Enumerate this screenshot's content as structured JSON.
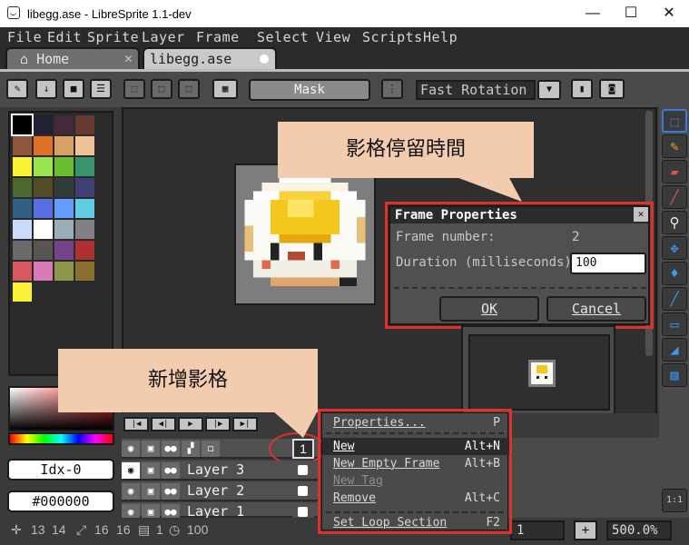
{
  "window": {
    "title": "libegg.ase - LibreSprite 1.1-dev",
    "minimize": "—",
    "maximize": "☐",
    "close": "✕"
  },
  "menubar": [
    "File",
    "Edit",
    "Sprite",
    "Layer",
    "Frame",
    "Select",
    "View",
    "Scripts",
    "Help"
  ],
  "tabs": [
    {
      "label": "Home",
      "icon": "home-icon",
      "close": "✕"
    },
    {
      "label": "libegg.ase",
      "modified": true
    }
  ],
  "toolbar": {
    "mask_label": "Mask",
    "rotation_algorithm": "Fast Rotation"
  },
  "palette": {
    "colors": [
      "#000000",
      "#222034",
      "#45283c",
      "#663931",
      "#8f563b",
      "#df7126",
      "#d9a066",
      "#eec39a",
      "#fbf236",
      "#99e550",
      "#6abe30",
      "#37946e",
      "#4b692f",
      "#524b24",
      "#323c39",
      "#3f3f74",
      "#306082",
      "#5b6ee1",
      "#639bff",
      "#5fcde4",
      "#cbdbfc",
      "#ffffff",
      "#9badb7",
      "#847e87",
      "#696a6a",
      "#595652",
      "#76428a",
      "#ac3232",
      "#d95763",
      "#d77bba",
      "#8f974a",
      "#8a6f30",
      "#fbf236"
    ]
  },
  "color_bar": {
    "index": "Idx-0",
    "hex": "#000000"
  },
  "dialog": {
    "title": "Frame Properties",
    "frame_number_label": "Frame number:",
    "frame_number_value": "2",
    "duration_label": "Duration (milliseconds):",
    "duration_value": "100",
    "ok_label": "OK",
    "cancel_label": "Cancel"
  },
  "callouts": {
    "top": "影格停留時間",
    "bottom": "新增影格"
  },
  "timeline": {
    "current_frame": "1",
    "layers": [
      "Layer 3",
      "Layer 2",
      "Layer 1"
    ]
  },
  "context_menu": [
    {
      "label": "Properties...",
      "shortcut": "P",
      "state": "normal"
    },
    {
      "label": "New",
      "shortcut": "Alt+N",
      "state": "selected"
    },
    {
      "label": "New Empty Frame",
      "shortcut": "Alt+B",
      "state": "normal"
    },
    {
      "label": "New Tag",
      "shortcut": "",
      "state": "disabled"
    },
    {
      "label": "Remove",
      "shortcut": "Alt+C",
      "state": "normal"
    },
    {
      "label": "Set Loop Section",
      "shortcut": "F2",
      "state": "normal"
    }
  ],
  "status": {
    "pos_x": "13",
    "pos_y": "14",
    "size_w": "16",
    "size_h": "16",
    "frame": "1",
    "duration": "100",
    "frame_field": "1",
    "zoom": "500.0%",
    "ratio": "1:1"
  },
  "colors": {
    "accent_red": "#e0302c",
    "callout_bg": "#f3ccb0"
  }
}
